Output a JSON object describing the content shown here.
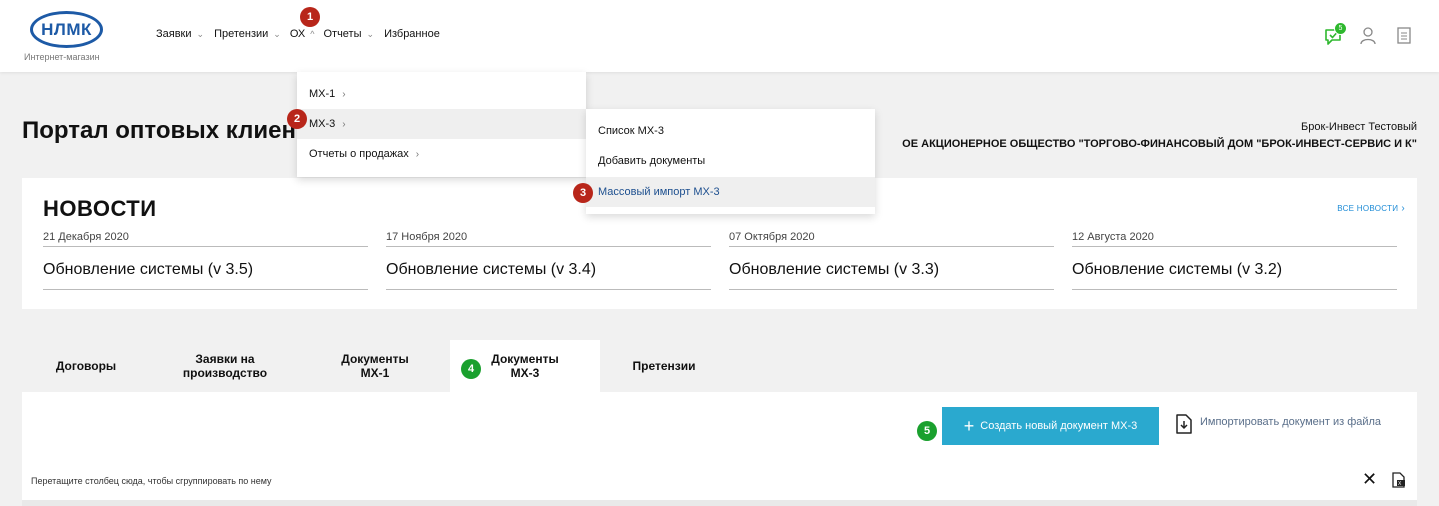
{
  "header": {
    "logo_text": "НЛМК",
    "logo_subtitle": "Интернет-магазин",
    "nav": [
      {
        "label": "Заявки",
        "chevron": "down"
      },
      {
        "label": "Претензии",
        "chevron": "down"
      },
      {
        "label": "ОХ",
        "chevron": "up"
      },
      {
        "label": "Отчеты",
        "chevron": "down"
      },
      {
        "label": "Избранное"
      }
    ],
    "icons": [
      "chat-icon",
      "user-icon",
      "document-icon"
    ],
    "chat_badge": "5"
  },
  "markers": {
    "m1": "1",
    "m2": "2",
    "m3": "3",
    "m4": "4",
    "m5": "5"
  },
  "dropdown_oh": {
    "items": [
      {
        "label": "МХ-1"
      },
      {
        "label": "МХ-3"
      },
      {
        "label": "Отчеты о продажах"
      }
    ]
  },
  "dropdown_mx3": {
    "items": [
      {
        "label": "Список МХ-3"
      },
      {
        "label": "Добавить документы"
      },
      {
        "label": "Массовый импорт МХ-3"
      }
    ]
  },
  "page": {
    "title": "Портал оптовых клиен",
    "user_name": "Брок-Инвест Тестовый",
    "company": "ОЕ АКЦИОНЕРНОЕ ОБЩЕСТВО \"ТОРГОВО-ФИНАНСОВЫЙ ДОМ \"БРОК-ИНВЕСТ-СЕРВИС И К\""
  },
  "news": {
    "title": "НОВОСТИ",
    "all_link": "ВСЕ НОВОСТИ",
    "items": [
      {
        "date": "21 Декабря 2020",
        "headline": "Обновление системы (v 3.5)"
      },
      {
        "date": "17 Ноября 2020",
        "headline": "Обновление системы (v 3.4)"
      },
      {
        "date": "07 Октября 2020",
        "headline": "Обновление системы (v 3.3)"
      },
      {
        "date": "12 Августа 2020",
        "headline": "Обновление системы (v 3.2)"
      }
    ]
  },
  "tabs": [
    {
      "line1": "Договоры",
      "line2": ""
    },
    {
      "line1": "Заявки на",
      "line2": "производство"
    },
    {
      "line1": "Документы",
      "line2": "МХ-1"
    },
    {
      "line1": "Документы",
      "line2": "МХ-3",
      "active": true
    },
    {
      "line1": "Претензии",
      "line2": ""
    }
  ],
  "panel": {
    "create_button": "Создать новый документ МХ-3",
    "import_link": "Импортировать документ из файла",
    "group_hint": "Перетащите столбец сюда, чтобы сгруппировать по нему"
  },
  "colors": {
    "brand_blue": "#1d5aa6",
    "button": "#2aa9cf",
    "marker_red": "#b8261a",
    "marker_green": "#1aa02e"
  }
}
